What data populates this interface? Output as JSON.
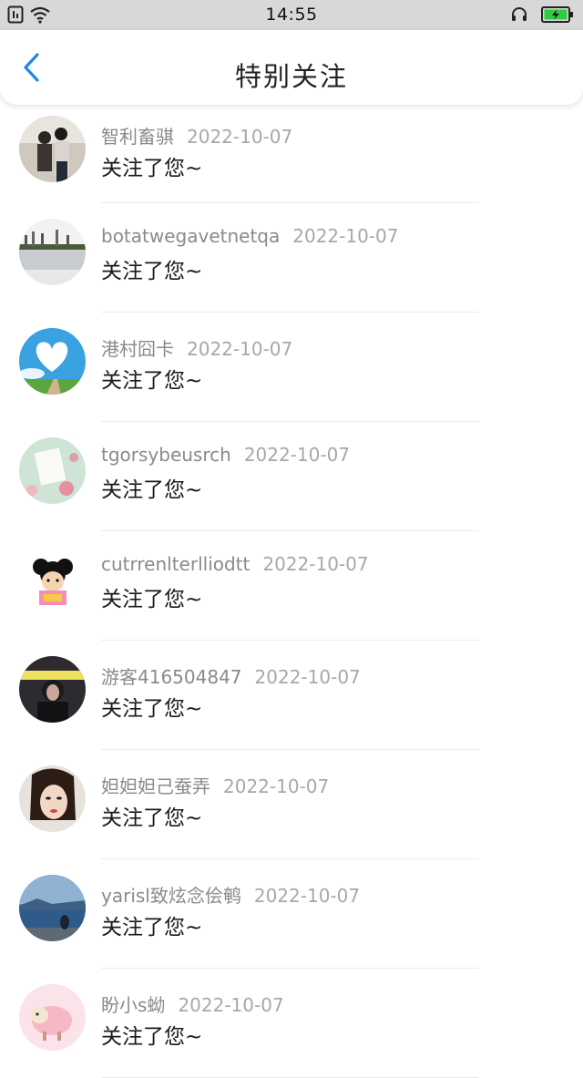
{
  "status_bar": {
    "time": "14:55",
    "icons": [
      "sim-icon",
      "wifi-icon",
      "headphones-icon",
      "battery-charging-icon"
    ],
    "battery_color": "#2ecc40"
  },
  "header": {
    "title": "特别关注",
    "back_icon": "chevron-left-icon",
    "accent_color": "#1e88e5"
  },
  "list": {
    "items": [
      {
        "name": "智利畜骐",
        "date": "2022-10-07",
        "message": "关注了您~",
        "avatar": "couple-photo"
      },
      {
        "name": "botatwegavetnetqa",
        "date": "2022-10-07",
        "message": "关注了您~",
        "avatar": "landscape-lake"
      },
      {
        "name": "港村囧卡",
        "date": "2022-10-07",
        "message": "关注了您~",
        "avatar": "heart-cloud-sky"
      },
      {
        "name": "tgorsybeusrch",
        "date": "2022-10-07",
        "message": "关注了您~",
        "avatar": "for-you-card"
      },
      {
        "name": "cutrrenlterlliodtt",
        "date": "2022-10-07",
        "message": "关注了您~",
        "avatar": "cartoon-girl"
      },
      {
        "name": "游客416504847",
        "date": "2022-10-07",
        "message": "关注了您~",
        "avatar": "dark-portrait"
      },
      {
        "name": "妲妲妲己蚕弄",
        "date": "2022-10-07",
        "message": "关注了您~",
        "avatar": "woman-portrait"
      },
      {
        "name": "yarisl致炫念侩鹌",
        "date": "2022-10-07",
        "message": "关注了您~",
        "avatar": "sea-view"
      },
      {
        "name": "盼小s蚴",
        "date": "2022-10-07",
        "message": "关注了您~",
        "avatar": "pink-sheep"
      }
    ]
  }
}
